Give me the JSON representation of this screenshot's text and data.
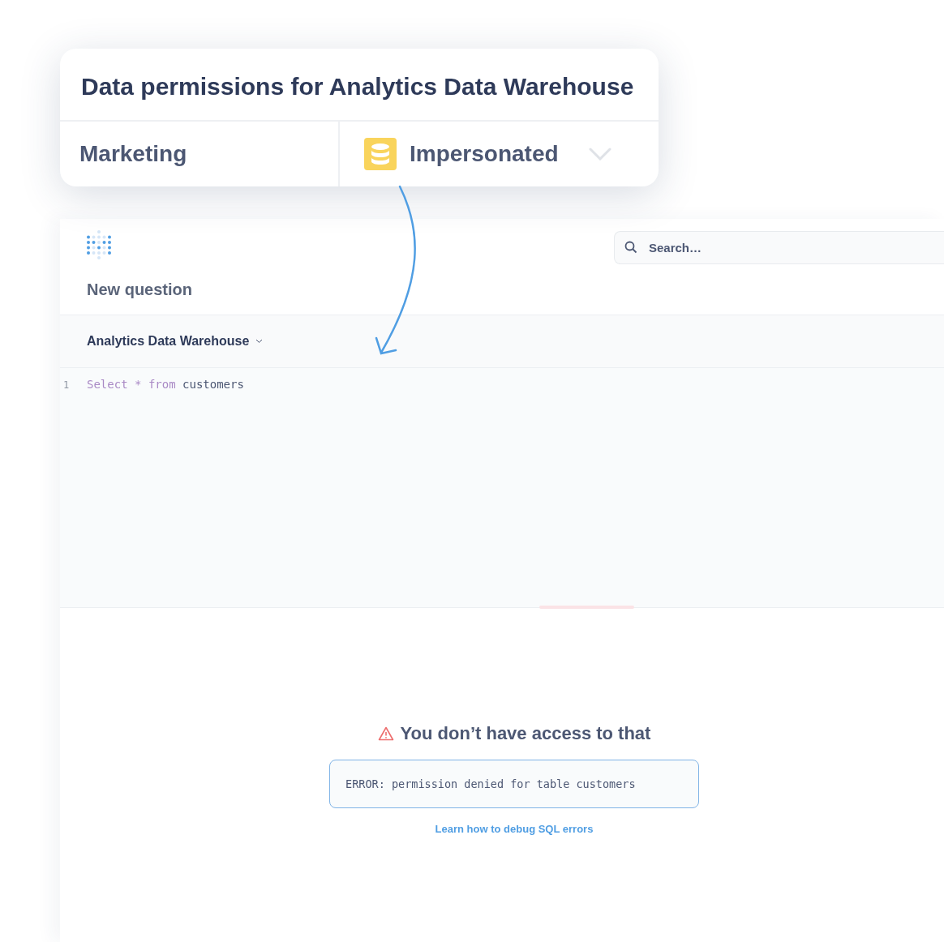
{
  "permissions_card": {
    "title": "Data permissions for Analytics Data Warehouse",
    "group": "Marketing",
    "access": {
      "label": "Impersonated"
    }
  },
  "app": {
    "search": {
      "placeholder": "Search…"
    },
    "question_title": "New question",
    "database": "Analytics Data Warehouse",
    "editor": {
      "lines": [
        {
          "number": "1",
          "tokens": [
            {
              "kind": "keyword",
              "text": "Select"
            },
            {
              "kind": "operator",
              "text": "*"
            },
            {
              "kind": "keyword",
              "text": "from"
            },
            {
              "kind": "identifier",
              "text": "customers"
            }
          ]
        }
      ]
    },
    "error": {
      "title": "You don’t have access to that",
      "message": "ERROR: permission denied for table customers",
      "link": "Learn how to debug SQL errors"
    }
  }
}
